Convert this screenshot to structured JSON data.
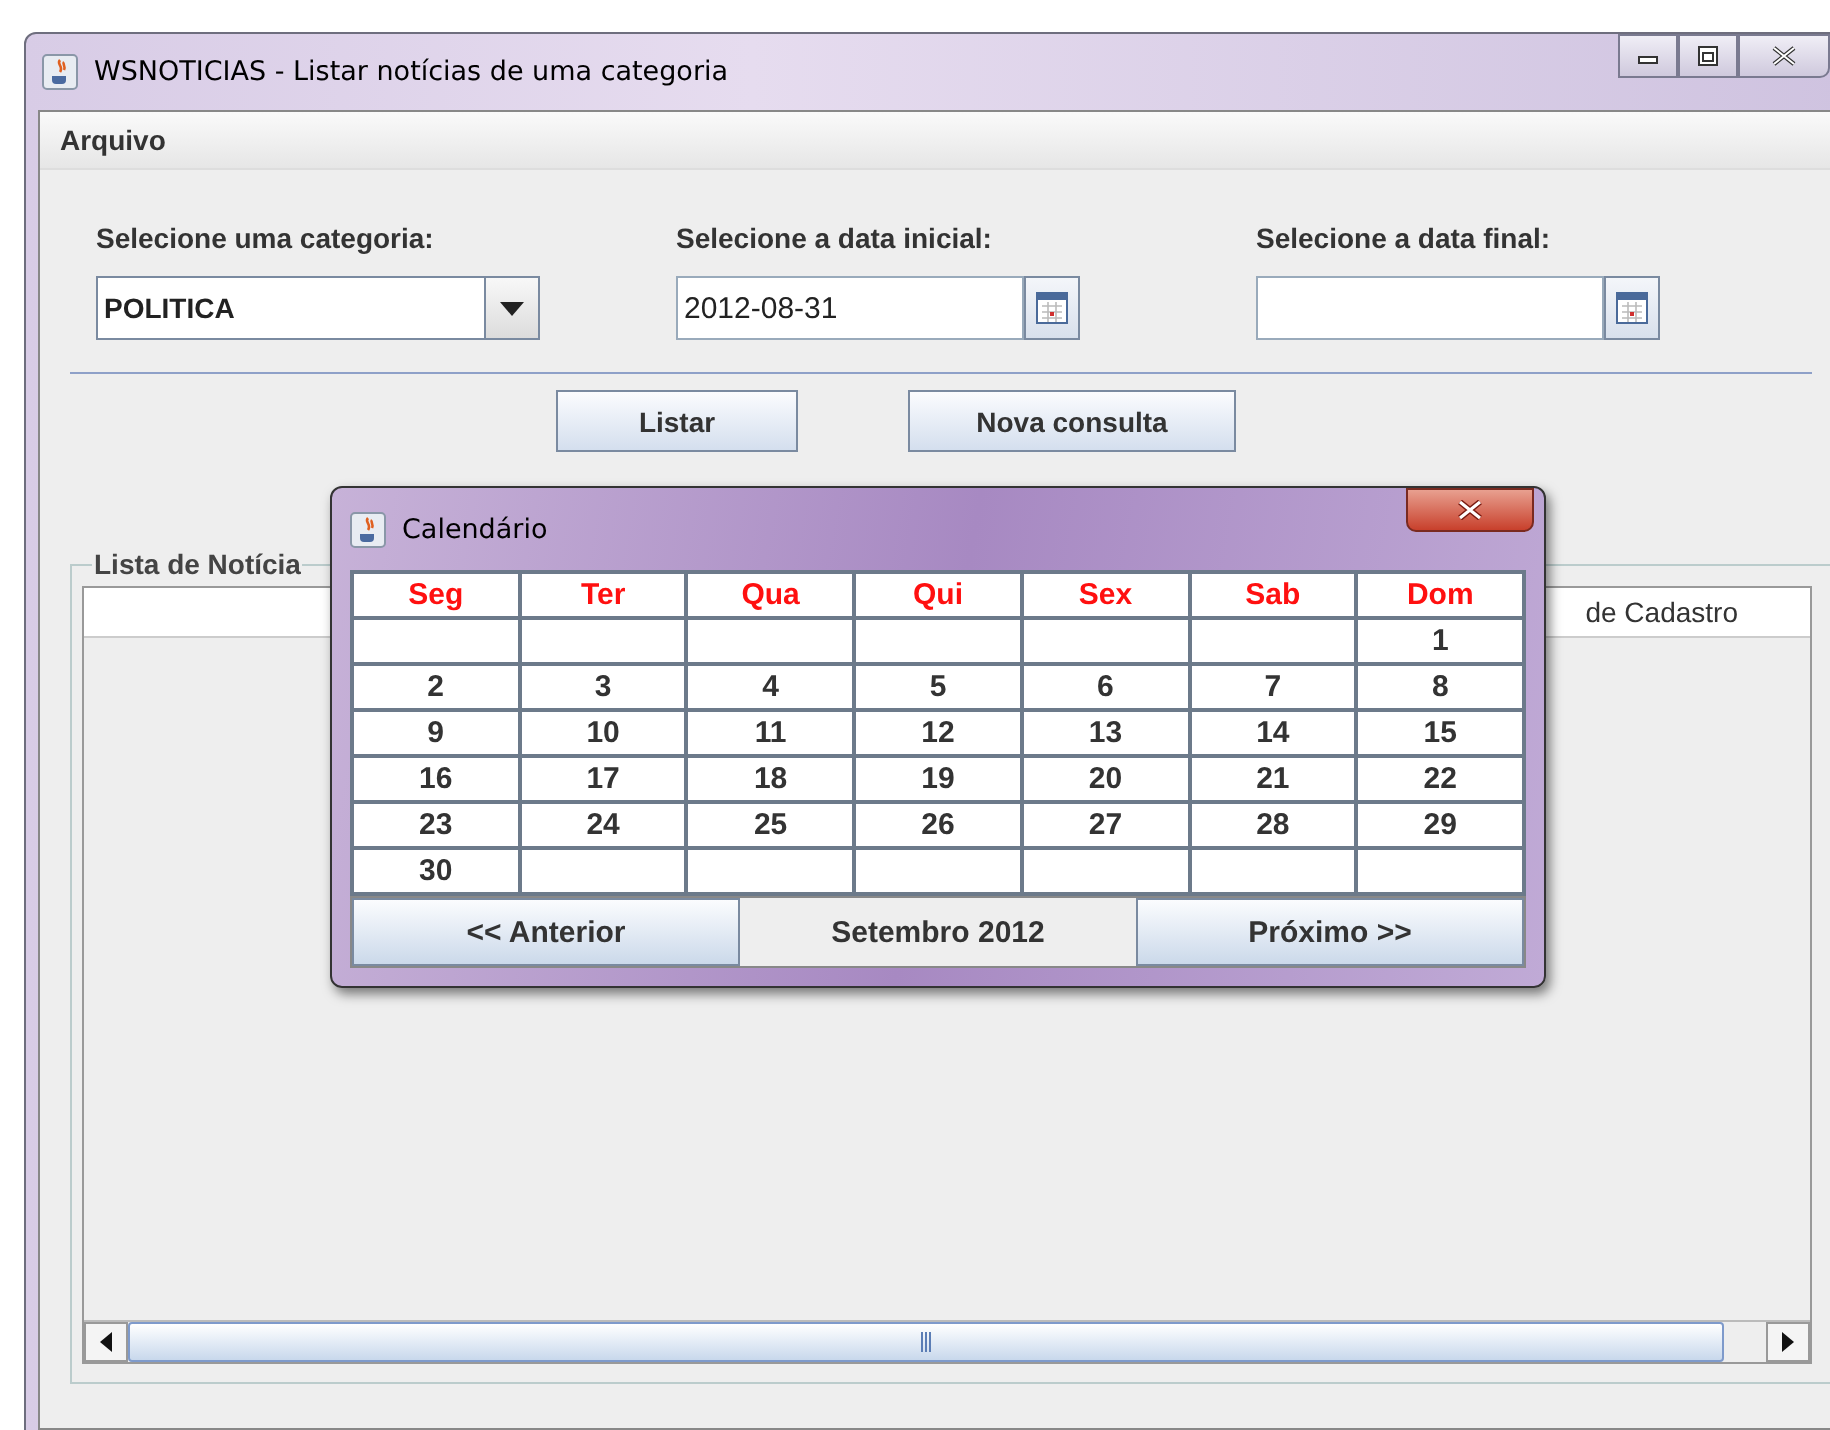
{
  "window": {
    "title": "WSNOTICIAS - Listar notícias de uma categoria"
  },
  "menu": [
    "Arquivo"
  ],
  "form": {
    "category": {
      "label": "Selecione uma categoria:",
      "value": "POLITICA"
    },
    "start_date": {
      "label": "Selecione a data inicial:",
      "value": "2012-08-31"
    },
    "end_date": {
      "label": "Selecione a data final:"
    }
  },
  "buttons": [
    "Listar",
    "Nova consulta"
  ],
  "list_panel": {
    "title": "Lista de Notícia",
    "columns": [
      "de Cadastro"
    ]
  },
  "calendar": {
    "title": "Calendário",
    "weekdays": [
      "Seg",
      "Ter",
      "Qua",
      "Qui",
      "Sex",
      "Sab",
      "Dom"
    ],
    "weeks": [
      {
        "cells": [
          {
            "kind": "blank"
          },
          {
            "kind": "blank"
          },
          {
            "kind": "blank"
          },
          {
            "kind": "blank"
          },
          {
            "kind": "blank"
          },
          {
            "kind": "blank"
          },
          {
            "kind": "day",
            "text": "1"
          }
        ]
      },
      {
        "cells": [
          {
            "kind": "day",
            "text": "2"
          },
          {
            "kind": "day",
            "text": "3"
          },
          {
            "kind": "day",
            "text": "4"
          },
          {
            "kind": "day",
            "text": "5"
          },
          {
            "kind": "day",
            "text": "6"
          },
          {
            "kind": "day",
            "text": "7"
          },
          {
            "kind": "day",
            "text": "8"
          }
        ]
      },
      {
        "cells": [
          {
            "kind": "day",
            "text": "9"
          },
          {
            "kind": "day",
            "text": "10"
          },
          {
            "kind": "day",
            "text": "11"
          },
          {
            "kind": "day",
            "text": "12"
          },
          {
            "kind": "day",
            "text": "13"
          },
          {
            "kind": "day",
            "text": "14"
          },
          {
            "kind": "day",
            "text": "15"
          }
        ]
      },
      {
        "cells": [
          {
            "kind": "day",
            "text": "16"
          },
          {
            "kind": "day",
            "text": "17"
          },
          {
            "kind": "day",
            "text": "18"
          },
          {
            "kind": "day",
            "text": "19"
          },
          {
            "kind": "day",
            "text": "20"
          },
          {
            "kind": "day",
            "text": "21"
          },
          {
            "kind": "day",
            "text": "22"
          }
        ]
      },
      {
        "cells": [
          {
            "kind": "day",
            "text": "23"
          },
          {
            "kind": "day",
            "text": "24"
          },
          {
            "kind": "day",
            "text": "25"
          },
          {
            "kind": "day",
            "text": "26"
          },
          {
            "kind": "day",
            "text": "27"
          },
          {
            "kind": "day",
            "text": "28"
          },
          {
            "kind": "day",
            "text": "29"
          }
        ]
      },
      {
        "cells": [
          {
            "kind": "day",
            "text": "30"
          },
          {
            "kind": "blank"
          },
          {
            "kind": "blank"
          },
          {
            "kind": "blank"
          },
          {
            "kind": "blank"
          },
          {
            "kind": "blank"
          },
          {
            "kind": "blank"
          }
        ]
      }
    ],
    "previous": "<< Anterior",
    "month": "Setembro 2012",
    "next": "Próximo >>"
  }
}
